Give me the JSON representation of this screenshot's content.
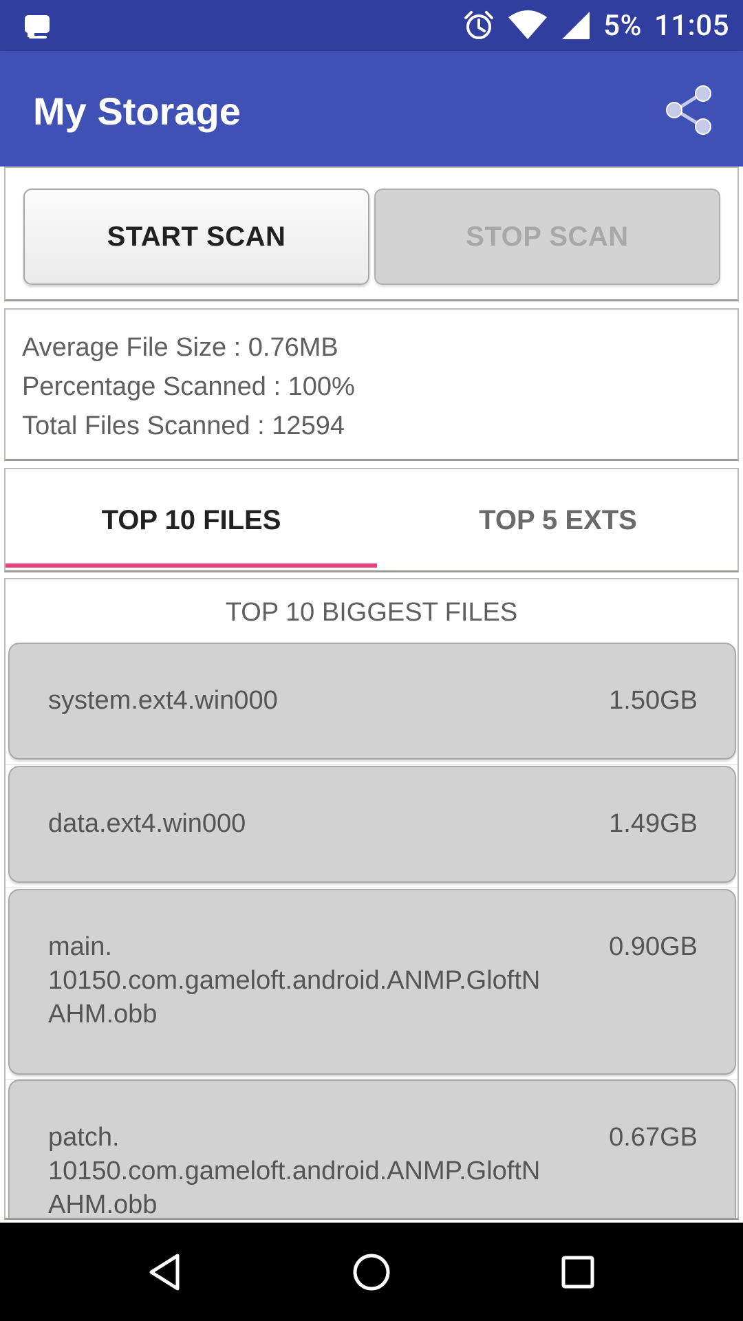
{
  "status_bar": {
    "battery": "5%",
    "time": "11:05",
    "icons": [
      "notification-app-icon",
      "alarm-icon",
      "wifi-icon",
      "signal-icon"
    ]
  },
  "app_bar": {
    "title": "My Storage",
    "share_icon": "share-icon"
  },
  "buttons": {
    "start": "START SCAN",
    "stop": "STOP SCAN"
  },
  "stats": {
    "average": "Average File Size : 0.76MB",
    "percentage": "Percentage Scanned : 100%",
    "total": "Total Files Scanned : 12594"
  },
  "tabs": {
    "items": [
      "TOP 10 FILES",
      "TOP 5 EXTS"
    ],
    "selected": "TOP 10 FILES"
  },
  "list": {
    "heading": "TOP 10 BIGGEST FILES",
    "rows": [
      {
        "name": "system.ext4.win000",
        "size": "1.50GB"
      },
      {
        "name": "data.ext4.win000",
        "size": "1.49GB"
      },
      {
        "name": "main.\n10150.com.gameloft.android.ANMP.GloftN\nAHM.obb",
        "size": "0.90GB"
      },
      {
        "name": "patch.\n10150.com.gameloft.android.ANMP.GloftN\nAHM.obb",
        "size": "0.67GB"
      }
    ]
  },
  "nav_bar": {
    "icons": [
      "back-icon",
      "home-icon",
      "recents-icon"
    ]
  },
  "colors": {
    "status_bar": "#303f9f",
    "app_bar": "#3f51b5",
    "tab_indicator": "#ec407a",
    "nav_bar": "#000000"
  }
}
